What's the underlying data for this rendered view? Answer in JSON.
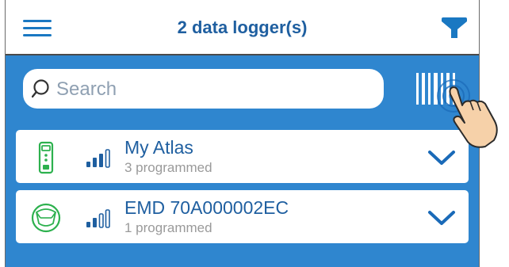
{
  "header": {
    "title": "2 data logger(s)"
  },
  "search": {
    "placeholder": "Search",
    "value": ""
  },
  "loggers": [
    {
      "name": "My Atlas",
      "status": "3 programmed",
      "device_icon": "atlas-device-icon",
      "signal_icon": "signal-strength-icon"
    },
    {
      "name": "EMD 70A000002EC",
      "status": "1 programmed",
      "device_icon": "emd-device-icon",
      "signal_icon": "signal-strength-icon"
    }
  ],
  "colors": {
    "primary_blue": "#2f86cf",
    "title_blue": "#1f5fa0",
    "icon_blue": "#1a78c2",
    "device_green": "#2db14e",
    "secondary_text": "#9a9a9a"
  }
}
